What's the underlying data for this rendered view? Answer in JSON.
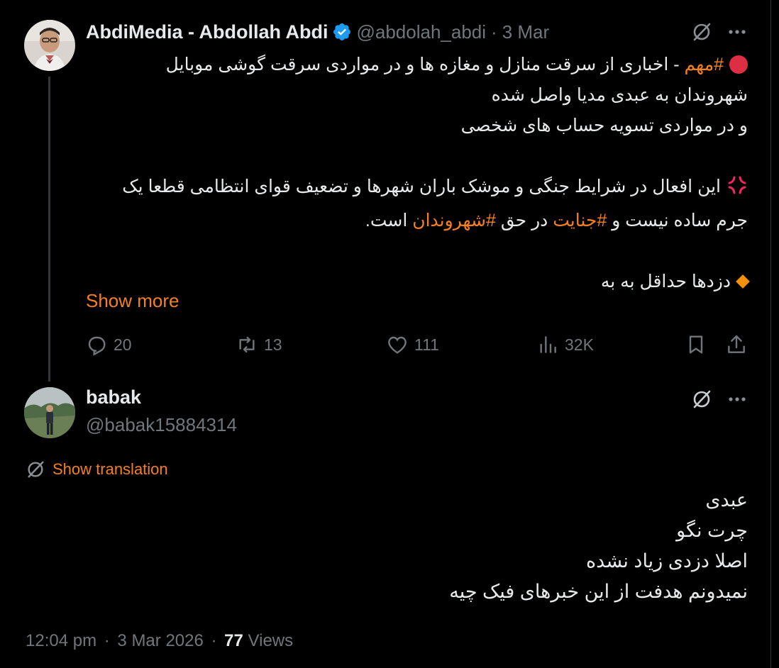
{
  "tweet": {
    "author": {
      "display_name": "AbdiMedia - Abdollah Abdi",
      "handle": "@abdolah_abdi",
      "verified": true
    },
    "date": "3 Mar",
    "separator": "·",
    "body": {
      "line1_hashtag": "#مهم",
      "line1_rest": " - اخباری از سرقت منازل و مغازه ها و در مواردی سرقت گوشی موبایل",
      "line2": "شهروندان به عبدی مدیا واصل شده",
      "line3": "و در مواردی تسویه حساب های شخصی",
      "line5": "اين افعال در شرايط جنگی و موشک باران شهرها و تضعیف قوای انتظامی قطعا یک",
      "line6_part1": "جرم ساده نیست و ",
      "line6_hashtag1": "#جنایت",
      "line6_part2": " در حق ",
      "line6_hashtag2": "#شهروندان",
      "line6_part3": " است.",
      "line8": "دزدها حداقل به به"
    },
    "show_more": "Show more",
    "actions": {
      "replies": "20",
      "reposts": "13",
      "likes": "111",
      "views": "32K"
    }
  },
  "reply": {
    "author": {
      "display_name": "babak",
      "handle": "@babak15884314"
    },
    "show_translation": "Show translation",
    "body": [
      "عبدی",
      "چرت نگو",
      "اصلا دزدی زیاد نشده",
      "نمیدونم هدفت از این خبرهای فیک چیه"
    ],
    "timestamp": "12:04 pm",
    "date": "3 Mar 2026",
    "separator": "·",
    "views_count": "77",
    "views_label": "Views"
  },
  "colors": {
    "accent": "#f4801f",
    "verified": "#1d9bf0",
    "secondary_text": "#71767b",
    "primary_text": "#e7e9ea",
    "background": "#000000"
  },
  "icons": {
    "grok": "grok-icon",
    "more": "more-icon",
    "reply": "reply-icon",
    "repost": "repost-icon",
    "like": "heart-icon",
    "views": "views-icon",
    "bookmark": "bookmark-icon",
    "share": "share-icon",
    "translate": "globe-icon"
  }
}
